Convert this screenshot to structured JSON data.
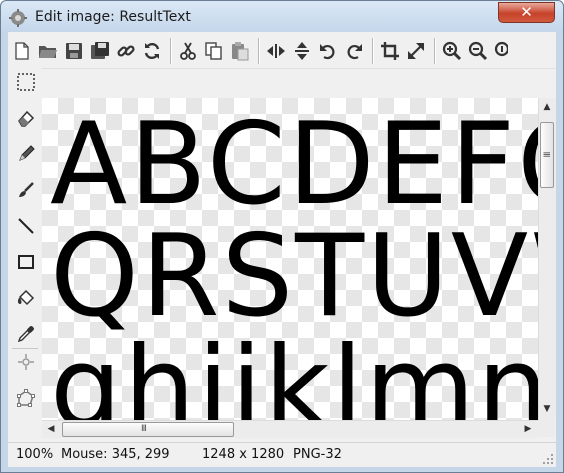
{
  "window": {
    "title": "Edit image: ResultText",
    "close_glyph": "✕"
  },
  "toolbar": {
    "items": [
      {
        "name": "new-icon"
      },
      {
        "name": "open-icon"
      },
      {
        "name": "save-icon"
      },
      {
        "name": "save-as-icon"
      },
      {
        "name": "link-icon"
      },
      {
        "name": "refresh-icon"
      },
      {
        "name": "cut-icon"
      },
      {
        "name": "copy-icon"
      },
      {
        "name": "paste-icon"
      },
      {
        "name": "move-horizontal-icon"
      },
      {
        "name": "move-vertical-icon"
      },
      {
        "name": "rotate-left-icon"
      },
      {
        "name": "rotate-right-icon"
      },
      {
        "name": "crop-icon"
      },
      {
        "name": "resize-icon"
      },
      {
        "name": "zoom-in-icon"
      },
      {
        "name": "zoom-out-icon"
      },
      {
        "name": "zoom-reset-icon"
      }
    ]
  },
  "tools": [
    {
      "name": "select-rect-icon"
    },
    {
      "name": "eraser-icon"
    },
    {
      "name": "pencil-icon"
    },
    {
      "name": "brush-icon"
    },
    {
      "name": "line-icon"
    },
    {
      "name": "rectangle-icon"
    },
    {
      "name": "fill-bucket-icon"
    },
    {
      "name": "eyedropper-icon"
    },
    {
      "name": "hotspot-icon"
    },
    {
      "name": "polygon-icon"
    }
  ],
  "canvas": {
    "rows": [
      "ABCDEFG",
      "QRSTUVW",
      "ghijklmn"
    ]
  },
  "scroll": {
    "grip": "III"
  },
  "status": {
    "zoom": "100%",
    "mouse": "Mouse: 345, 299",
    "size": "1248 x 1280",
    "format": "PNG-32"
  }
}
